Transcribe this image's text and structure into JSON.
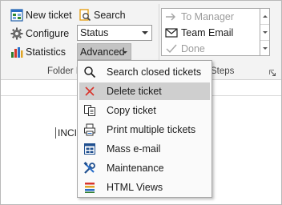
{
  "ribbon": {
    "new_ticket": {
      "label": "New ticket",
      "icon": "new-ticket-icon"
    },
    "search": {
      "label": "Search",
      "icon": "search-icon"
    },
    "configure": {
      "label": "Configure",
      "icon": "gear-icon"
    },
    "statistics": {
      "label": "Statistics",
      "icon": "bar-chart-icon"
    },
    "status_select": {
      "value": "Status"
    },
    "advanced": {
      "label": "Advanced"
    },
    "folder_group_label": "Folder I",
    "steps_group_label": "Steps"
  },
  "quick_steps": {
    "items": [
      {
        "label": "To Manager",
        "icon": "forward-arrow-icon",
        "enabled": false
      },
      {
        "label": "Team Email",
        "icon": "envelope-icon",
        "enabled": true
      },
      {
        "label": "Done",
        "icon": "checkmark-icon",
        "enabled": false
      }
    ]
  },
  "content": {
    "column_text": "INCI"
  },
  "advanced_menu": {
    "items": [
      {
        "label": "Search closed tickets",
        "icon": "magnifier-icon",
        "highlighted": false
      },
      {
        "label": "Delete ticket",
        "icon": "delete-x-icon",
        "highlighted": true
      },
      {
        "label": "Copy ticket",
        "icon": "copy-icon",
        "highlighted": false
      },
      {
        "label": "Print multiple tickets",
        "icon": "printer-icon",
        "highlighted": false
      },
      {
        "label": "Mass e-mail",
        "icon": "mass-email-icon",
        "highlighted": false
      },
      {
        "label": "Maintenance",
        "icon": "tools-icon",
        "highlighted": false
      },
      {
        "label": "HTML Views",
        "icon": "html-views-icon",
        "highlighted": false
      }
    ]
  },
  "colors": {
    "ribbon_bg": "#f3f3f3",
    "menu_highlight": "#cfcfcf",
    "delete_red": "#d9342b",
    "disabled_text": "#9c9c9c"
  }
}
